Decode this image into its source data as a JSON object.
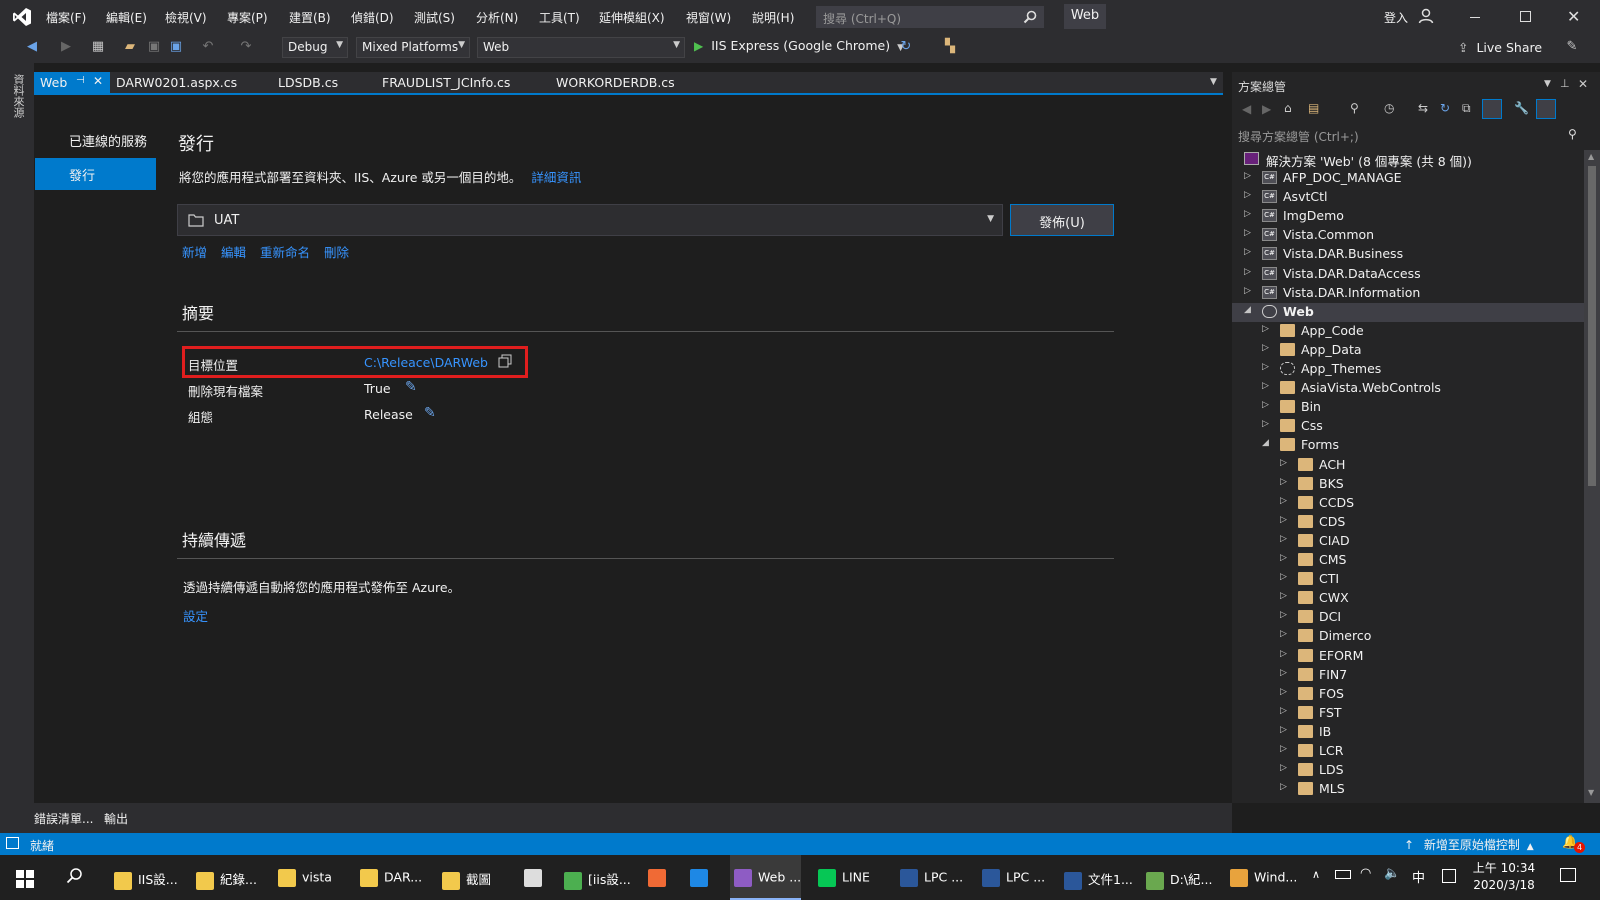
{
  "menu": [
    "檔案(F)",
    "編輯(E)",
    "檢視(V)",
    "專案(P)",
    "建置(B)",
    "偵錯(D)",
    "測試(S)",
    "分析(N)",
    "工具(T)",
    "延伸模組(X)",
    "視窗(W)",
    "說明(H)"
  ],
  "search": {
    "placeholder": "搜尋 (Ctrl+Q)"
  },
  "title": "Web",
  "signin": "登入",
  "toolbar": {
    "config": "Debug",
    "platform": "Mixed Platforms",
    "project": "Web",
    "run": "IIS Express (Google Chrome)",
    "live_share": "Live Share"
  },
  "left_rail": "資料來源",
  "tabs": [
    {
      "label": "Web",
      "active": true
    },
    {
      "label": "DARW0201.aspx.cs"
    },
    {
      "label": "LDSDB.cs"
    },
    {
      "label": "FRAUDLIST_JCInfo.cs"
    },
    {
      "label": "WORKORDERDB.cs"
    }
  ],
  "publish": {
    "nav_connected": "已連線的服務",
    "nav_publish": "發行",
    "heading": "發行",
    "description": "將您的應用程式部署至資料夾、IIS、Azure 或另一個目的地。",
    "more_info": "詳細資訊",
    "profile": "UAT",
    "publish_button": "發佈(U)",
    "actions": [
      "新增",
      "編輯",
      "重新命名",
      "刪除"
    ],
    "summary_heading": "摘要",
    "summary": [
      {
        "label": "目標位置",
        "value": "C:\\Releace\\DARWeb"
      },
      {
        "label": "刪除現有檔案",
        "value": "True"
      },
      {
        "label": "組態",
        "value": "Release"
      }
    ],
    "cd_heading": "持續傳遞",
    "cd_description": "透過持續傳遞自動將您的應用程式發佈至 Azure。",
    "cd_setup": "設定"
  },
  "solution_explorer": {
    "title": "方案總管",
    "search_placeholder": "搜尋方案總管 (Ctrl+;)",
    "solution_label": "解決方案 'Web' (8 個專案 (共 8 個))",
    "items": [
      {
        "label": "AFP_DOC_MANAGE",
        "level": 1,
        "type": "project",
        "expanded": false
      },
      {
        "label": "AsvtCtl",
        "level": 1,
        "type": "project",
        "expanded": false
      },
      {
        "label": "ImgDemo",
        "level": 1,
        "type": "project",
        "expanded": false
      },
      {
        "label": "Vista.Common",
        "level": 1,
        "type": "project",
        "expanded": false
      },
      {
        "label": "Vista.DAR.Business",
        "level": 1,
        "type": "project",
        "expanded": false
      },
      {
        "label": "Vista.DAR.DataAccess",
        "level": 1,
        "type": "project",
        "expanded": false
      },
      {
        "label": "Vista.DAR.Information",
        "level": 1,
        "type": "project",
        "expanded": false
      },
      {
        "label": "Web",
        "level": 1,
        "type": "web",
        "expanded": true,
        "selected": true
      },
      {
        "label": "App_Code",
        "level": 2,
        "type": "folder",
        "expanded": false
      },
      {
        "label": "App_Data",
        "level": 2,
        "type": "folder",
        "expanded": false
      },
      {
        "label": "App_Themes",
        "level": 2,
        "type": "gear",
        "expanded": false
      },
      {
        "label": "AsiaVista.WebControls",
        "level": 2,
        "type": "folder",
        "expanded": false
      },
      {
        "label": "Bin",
        "level": 2,
        "type": "folder",
        "expanded": false
      },
      {
        "label": "Css",
        "level": 2,
        "type": "folder",
        "expanded": false
      },
      {
        "label": "Forms",
        "level": 2,
        "type": "folder",
        "expanded": true
      },
      {
        "label": "ACH",
        "level": 3,
        "type": "folder",
        "expanded": false
      },
      {
        "label": "BKS",
        "level": 3,
        "type": "folder",
        "expanded": false
      },
      {
        "label": "CCDS",
        "level": 3,
        "type": "folder",
        "expanded": false
      },
      {
        "label": "CDS",
        "level": 3,
        "type": "folder",
        "expanded": false
      },
      {
        "label": "CIAD",
        "level": 3,
        "type": "folder",
        "expanded": false
      },
      {
        "label": "CMS",
        "level": 3,
        "type": "folder",
        "expanded": false
      },
      {
        "label": "CTI",
        "level": 3,
        "type": "folder",
        "expanded": false
      },
      {
        "label": "CWX",
        "level": 3,
        "type": "folder",
        "expanded": false
      },
      {
        "label": "DCI",
        "level": 3,
        "type": "folder",
        "expanded": false
      },
      {
        "label": "Dimerco",
        "level": 3,
        "type": "folder",
        "expanded": false
      },
      {
        "label": "EFORM",
        "level": 3,
        "type": "folder",
        "expanded": false
      },
      {
        "label": "FIN7",
        "level": 3,
        "type": "folder",
        "expanded": false
      },
      {
        "label": "FOS",
        "level": 3,
        "type": "folder",
        "expanded": false
      },
      {
        "label": "FST",
        "level": 3,
        "type": "folder",
        "expanded": false
      },
      {
        "label": "IB",
        "level": 3,
        "type": "folder",
        "expanded": false
      },
      {
        "label": "LCR",
        "level": 3,
        "type": "folder",
        "expanded": false
      },
      {
        "label": "LDS",
        "level": 3,
        "type": "folder",
        "expanded": false
      },
      {
        "label": "MLS",
        "level": 3,
        "type": "folder",
        "expanded": false
      }
    ]
  },
  "bottom_tabs": [
    "錯誤清單...",
    "輸出"
  ],
  "status": {
    "ready": "就緒",
    "source_control": "新增至原始檔控制",
    "notifications": "4"
  },
  "taskbar": {
    "items": [
      {
        "label": "IIS設...",
        "color": "#f2c94c"
      },
      {
        "label": "紀錄...",
        "color": "#f2c94c"
      },
      {
        "label": "vista",
        "color": "#f2c94c"
      },
      {
        "label": "DAR...",
        "color": "#f2c94c"
      },
      {
        "label": "截圖",
        "color": "#f2c94c"
      },
      {
        "label": "",
        "color": "#dddddd"
      },
      {
        "label": "[iis設...",
        "color": "#4caf50"
      },
      {
        "label": "",
        "color": "#f06a35"
      },
      {
        "label": "",
        "color": "#1e88e5"
      },
      {
        "label": "Web ...",
        "color": "#8e5cc4"
      },
      {
        "label": "LINE",
        "color": "#06c755"
      },
      {
        "label": "LPC ...",
        "color": "#2b579a"
      },
      {
        "label": "LPC ...",
        "color": "#2b579a"
      },
      {
        "label": "文件1...",
        "color": "#2b579a"
      },
      {
        "label": "D:\\紀...",
        "color": "#6aa84f"
      },
      {
        "label": "Wind...",
        "color": "#e8a33d"
      }
    ],
    "ime": "中",
    "time": "上午 10:34",
    "date": "2020/3/18"
  }
}
